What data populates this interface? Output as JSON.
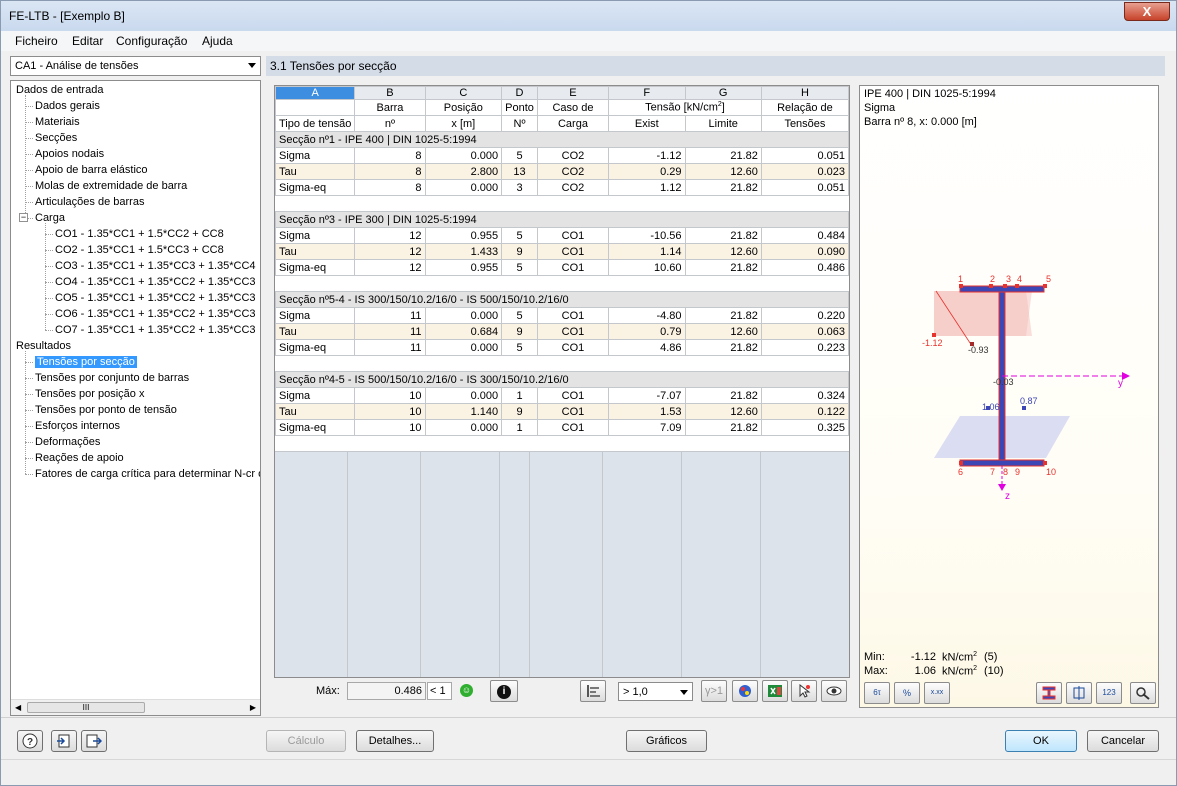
{
  "window": {
    "title": "FE-LTB - [Exemplo B]",
    "close_glyph": "X"
  },
  "menu": [
    "Ficheiro",
    "Editar",
    "Configuração",
    "Ajuda"
  ],
  "nav": {
    "combo_value": "CA1 - Análise de tensões",
    "input_root": "Dados de entrada",
    "input_items": [
      "Dados gerais",
      "Materiais",
      "Secções",
      "Apoios nodais",
      "Apoio de barra elástico",
      "Molas de extremidade de barra",
      "Articulações de barras"
    ],
    "carga_label": "Carga",
    "carga_toggle": "−",
    "carga_items": [
      "CO1 - 1.35*CC1 + 1.5*CC2 + CC8",
      "CO2 - 1.35*CC1 + 1.5*CC3 + CC8",
      "CO3 - 1.35*CC1 + 1.35*CC3 + 1.35*CC4",
      "CO4 - 1.35*CC1 + 1.35*CC2 + 1.35*CC3",
      "CO5 - 1.35*CC1 + 1.35*CC2 + 1.35*CC3",
      "CO6 - 1.35*CC1 + 1.35*CC2 + 1.35*CC3",
      "CO7 - 1.35*CC1 + 1.35*CC2 + 1.35*CC3"
    ],
    "results_root": "Resultados",
    "results_items": [
      "Tensões por secção",
      "Tensões por conjunto de barras",
      "Tensões por posição x",
      "Tensões por ponto de tensão",
      "Esforços internos",
      "Deformações",
      "Reações de apoio",
      "Fatores de carga crítica para determinar N-cr o"
    ],
    "selected_result": 0,
    "scroll_left": "◀",
    "scroll_right": "▶",
    "scroll_grip": "III"
  },
  "panel": {
    "title": "3.1 Tensões por secção"
  },
  "table": {
    "col_letters": [
      "A",
      "B",
      "C",
      "D",
      "E",
      "F",
      "G",
      "H"
    ],
    "hdr1": {
      "b": "Barra",
      "c": "Posição",
      "d": "Ponto",
      "e": "Caso de",
      "fg": "Tensão [kN/cm",
      "fg_sup": "2",
      "fg_close": "]",
      "h": "Relação de"
    },
    "hdr2": {
      "a": "Tipo de tensão",
      "b": "nº",
      "c": "x [m]",
      "d": "Nº",
      "e": "Carga",
      "f": "Exist",
      "g": "Limite",
      "h": "Tensões"
    },
    "sections": [
      {
        "title": "Secção nº1 - IPE 400 | DIN 1025-5:1994",
        "rows": [
          [
            "Sigma",
            "8",
            "0.000",
            "5",
            "CO2",
            "-1.12",
            "21.82",
            "0.051"
          ],
          [
            "Tau",
            "8",
            "2.800",
            "13",
            "CO2",
            "0.29",
            "12.60",
            "0.023"
          ],
          [
            "Sigma-eq",
            "8",
            "0.000",
            "3",
            "CO2",
            "1.12",
            "21.82",
            "0.051"
          ]
        ]
      },
      {
        "title": "Secção nº3 - IPE 300 | DIN 1025-5:1994",
        "rows": [
          [
            "Sigma",
            "12",
            "0.955",
            "5",
            "CO1",
            "-10.56",
            "21.82",
            "0.484"
          ],
          [
            "Tau",
            "12",
            "1.433",
            "9",
            "CO1",
            "1.14",
            "12.60",
            "0.090"
          ],
          [
            "Sigma-eq",
            "12",
            "0.955",
            "5",
            "CO1",
            "10.60",
            "21.82",
            "0.486"
          ]
        ]
      },
      {
        "title": "Secção nº5-4 - IS 300/150/10.2/16/0 - IS 500/150/10.2/16/0",
        "rows": [
          [
            "Sigma",
            "11",
            "0.000",
            "5",
            "CO1",
            "-4.80",
            "21.82",
            "0.220"
          ],
          [
            "Tau",
            "11",
            "0.684",
            "9",
            "CO1",
            "0.79",
            "12.60",
            "0.063"
          ],
          [
            "Sigma-eq",
            "11",
            "0.000",
            "5",
            "CO1",
            "4.86",
            "21.82",
            "0.223"
          ]
        ]
      },
      {
        "title": "Secção nº4-5 - IS 500/150/10.2/16/0 - IS 300/150/10.2/16/0",
        "rows": [
          [
            "Sigma",
            "10",
            "0.000",
            "1",
            "CO1",
            "-7.07",
            "21.82",
            "0.324"
          ],
          [
            "Tau",
            "10",
            "1.140",
            "9",
            "CO1",
            "1.53",
            "12.60",
            "0.122"
          ],
          [
            "Sigma-eq",
            "10",
            "0.000",
            "1",
            "CO1",
            "7.09",
            "21.82",
            "0.325"
          ]
        ]
      }
    ]
  },
  "bottom_bar": {
    "max_label": "Máx:",
    "max_value": "0.486",
    "lt1": "< 1",
    "filter_value": "> 1,0",
    "gt1_text": "γ>1",
    "ok_glyph": "☺",
    "info_glyph": "i"
  },
  "graph": {
    "line1": "IPE 400 | DIN 1025-5:1994",
    "line2": "Sigma",
    "line3": "Barra nº 8, x: 0.000 [m]",
    "points": [
      "1",
      "2",
      "3",
      "4",
      "5",
      "6",
      "7",
      "8",
      "9",
      "10"
    ],
    "val_top_left": "-1.12",
    "val_top_mid": "-0.93",
    "val_web": "-0.03",
    "val_bl": "1.06",
    "val_br": "0.87",
    "axis_y": "y",
    "axis_z": "z",
    "min_label": "Min:",
    "min_value": "-1.12",
    "min_unit": "kN/cm",
    "min_sup": "2",
    "min_point": "(5)",
    "max_label": "Max:",
    "max_value": "1.06",
    "max_unit": "kN/cm",
    "max_sup": "2",
    "max_point": "(10)",
    "btn_sigma": "6τ",
    "btn_percent": "%",
    "btn_decimal": "x.xx",
    "btn_123": "123"
  },
  "footer": {
    "calc": "Cálculo",
    "details": "Detalhes...",
    "graphics": "Gráficos",
    "ok": "OK",
    "cancel": "Cancelar"
  },
  "colors": {
    "header_blue": "#3d8ee0",
    "row_alt": "#faf2e3",
    "section_row": "#e3e3e3",
    "stress_red": "#e8322e",
    "stress_blue": "#3c46b4",
    "axis_magenta": "#e000e0"
  }
}
